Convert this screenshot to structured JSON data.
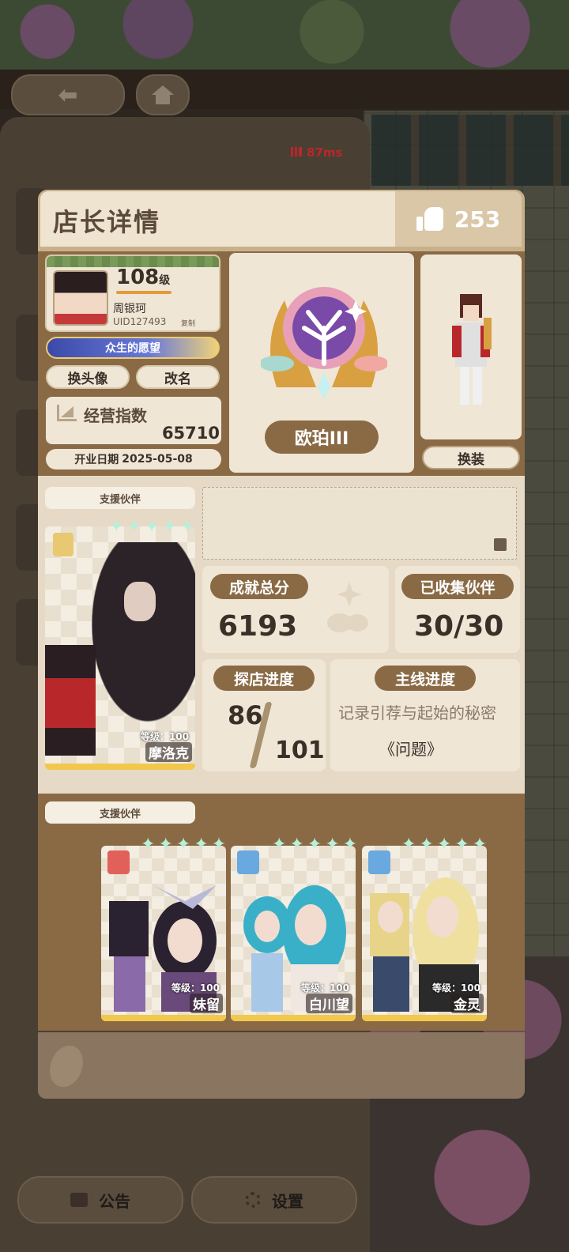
{
  "header": {
    "title": "店长详情",
    "likes": "253"
  },
  "network": {
    "latency": "87ms"
  },
  "profile": {
    "level": "108",
    "level_suffix": "级",
    "name": "周银珂",
    "uid": "UID127493",
    "copy_label": "复制",
    "title_badge": "众生的愿望",
    "change_avatar": "换头像",
    "rename": "改名",
    "business_label": "经营指数",
    "business_value": "65710",
    "open_date_label": "开业日期",
    "open_date": "2025-05-08"
  },
  "rank": {
    "name": "欧珀III"
  },
  "outfit": {
    "label": "换装"
  },
  "support": {
    "section_label": "支援伙伴",
    "main_partner": {
      "name": "摩洛克",
      "level": "等级：100"
    }
  },
  "stats": {
    "achievement_label": "成就总分",
    "achievement_value": "6193",
    "collected_label": "已收集伙伴",
    "collected_value": "30/30",
    "explore_label": "探店进度",
    "explore_current": "86",
    "explore_total": "101",
    "mainline_label": "主线进度",
    "mainline_chapter": "记录引荐与起始的秘密",
    "mainline_subtitle": "《问题》"
  },
  "partners": {
    "section_label": "支援伙伴",
    "items": [
      {
        "name": "妹留",
        "level": "等级：100",
        "badge_color": "#e2605a"
      },
      {
        "name": "白川望",
        "level": "等级：100",
        "badge_color": "#6aa8e0"
      },
      {
        "name": "金灵",
        "level": "等级：100",
        "badge_color": "#6aa8e0"
      }
    ]
  },
  "bottom": {
    "notice": "公告",
    "settings": "设置"
  },
  "colors": {
    "accent": "#8a6a45",
    "card_bg": "#efe6d6",
    "gold": "#f2c84c"
  }
}
